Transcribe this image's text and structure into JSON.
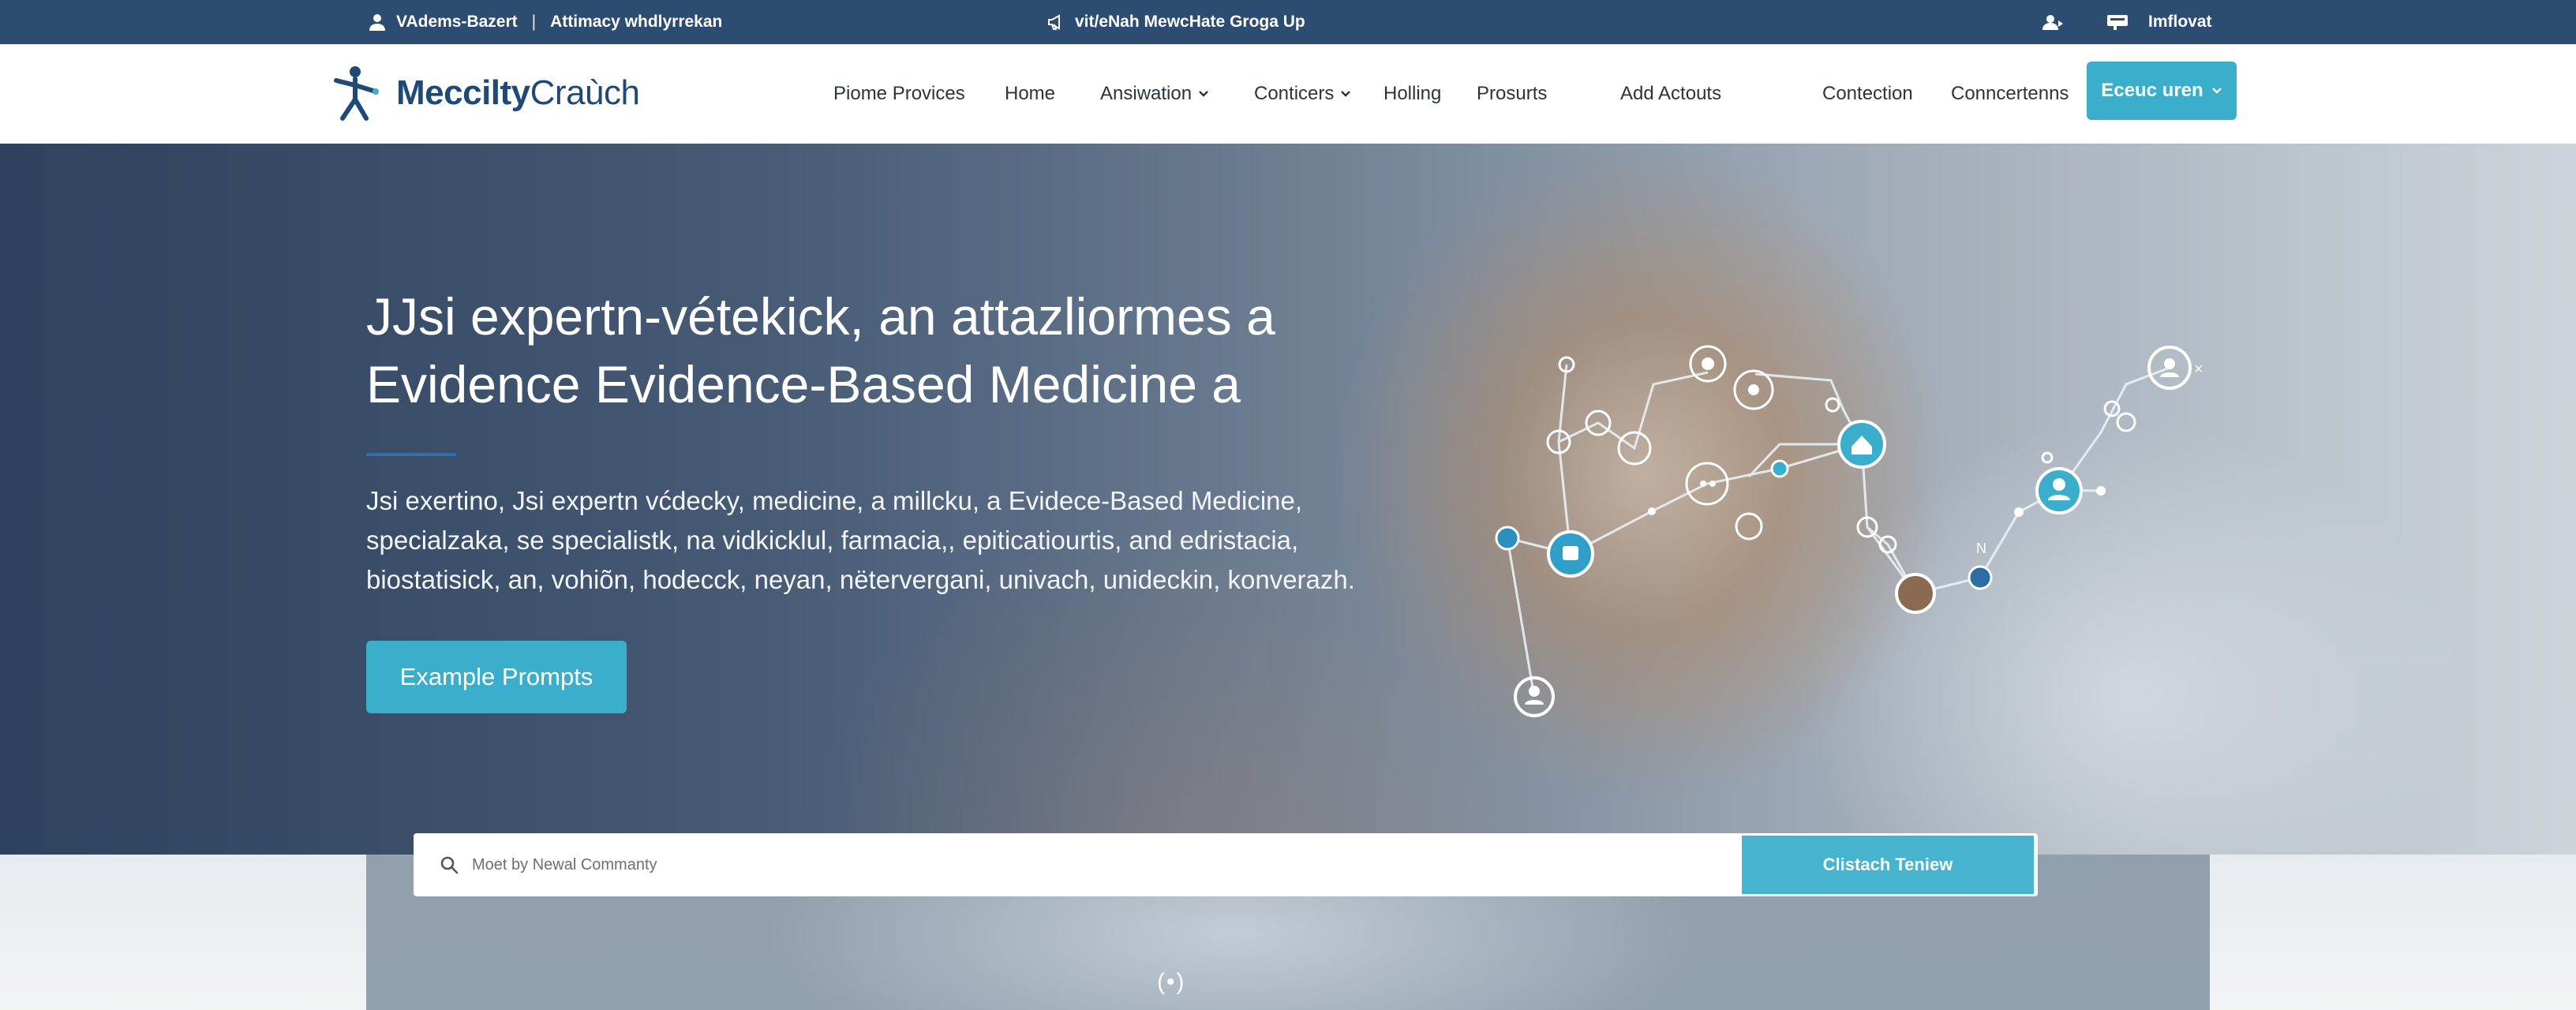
{
  "topbar": {
    "account_label": "VAdems-Bazert",
    "privacy_label": "Attimacy whdlyrrekan",
    "center_label": "vit/eNah MewcHate Groga Up",
    "right_label": "Imflovat"
  },
  "logo": {
    "bold": "Meccilty",
    "thin": "Craùch"
  },
  "nav": {
    "items": [
      {
        "label": "Piome Provices"
      },
      {
        "label": "Home"
      },
      {
        "label": "Ansiwation"
      },
      {
        "label": "Conticers"
      },
      {
        "label": "Holling"
      },
      {
        "label": "Prosurts"
      },
      {
        "label": "Add Actouts"
      },
      {
        "label": "Contection"
      },
      {
        "label": "Conncertenns"
      }
    ],
    "cta_label": "Eceuc uren"
  },
  "hero": {
    "heading_line1": "JJsi expertn-vétekick, an attazliormes a",
    "heading_line2": "Evidence Evidence-Based Medicine a",
    "sub_line1": "Jsi exertino, Jsi expertn vćdecky, medicine, a millcku, a Evidece-Based Medicine,",
    "sub_line2": "specialzaka, se specialistk, na vidkicklul, farmacia,, epiticatiourtis, and edristacia,",
    "sub_line3": "biostatisick, an, vohiõn, hodecck, neyan, nëtervergani, univach, unideckin, konverazh.",
    "button_label": "Example Prompts",
    "network_label": "N"
  },
  "search": {
    "placeholder": "Moet by Newal Commanty",
    "button_label": "Clistach Teniew"
  },
  "loader": "(•)",
  "colors": {
    "topbar": "#2c4c72",
    "accent": "#3aaecb",
    "logo": "#1f4a78"
  },
  "icons": {
    "topbar_account": "person-icon",
    "topbar_center": "megaphone-icon",
    "topbar_user": "user-icon",
    "topbar_card": "card-icon",
    "search": "search-icon",
    "dropdown": "chevron-down-icon"
  }
}
